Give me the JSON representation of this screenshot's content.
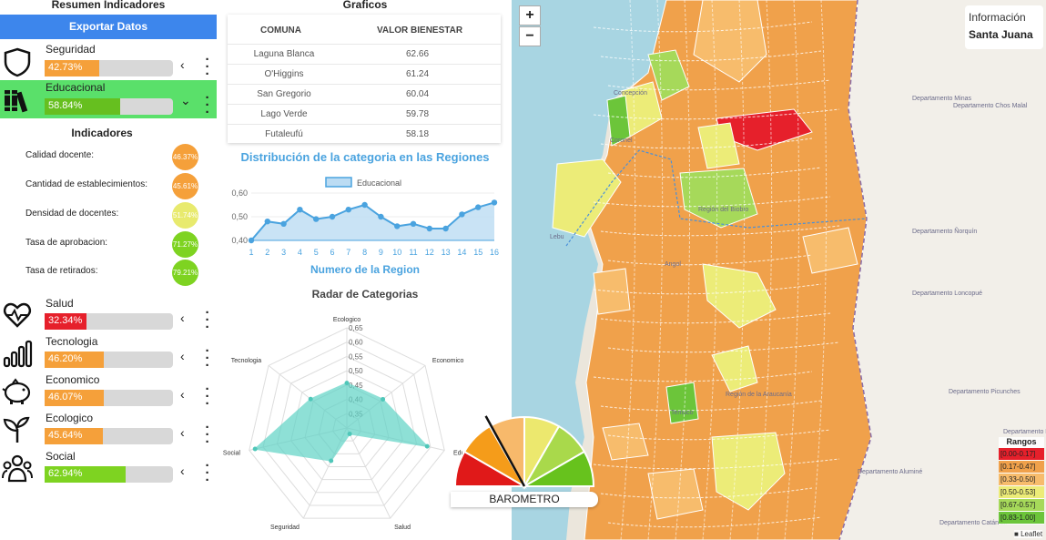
{
  "left": {
    "title": "Resumen Indicadores",
    "export_label": "Exportar Datos",
    "categories": [
      {
        "name": "Seguridad",
        "value": "42.73%",
        "pct": 42.73,
        "color": "#f5a03a",
        "icon": "shield-icon",
        "chevron": "‹"
      },
      {
        "name": "Educacional",
        "value": "58.84%",
        "pct": 58.84,
        "color": "#66bf1f",
        "icon": "books-icon",
        "chevron": "⌄"
      },
      {
        "name": "Salud",
        "value": "32.34%",
        "pct": 32.34,
        "color": "#e6202b",
        "icon": "heart-pulse-icon",
        "chevron": "‹"
      },
      {
        "name": "Tecnologia",
        "value": "46.20%",
        "pct": 46.2,
        "color": "#f5a03a",
        "icon": "signal-bars-icon",
        "chevron": "‹"
      },
      {
        "name": "Economico",
        "value": "46.07%",
        "pct": 46.07,
        "color": "#f5a03a",
        "icon": "piggy-bank-icon",
        "chevron": "‹"
      },
      {
        "name": "Ecologico",
        "value": "45.64%",
        "pct": 45.64,
        "color": "#f5a03a",
        "icon": "sprout-icon",
        "chevron": "‹"
      },
      {
        "name": "Social",
        "value": "62.94%",
        "pct": 62.94,
        "color": "#7ed321",
        "icon": "people-icon",
        "chevron": "‹"
      }
    ],
    "indicators_title": "Indicadores",
    "indicators": [
      {
        "label": "Calidad docente:",
        "value": "46.37%",
        "color": "#f5a03a"
      },
      {
        "label": "Cantidad de establecimientos:",
        "value": "45.61%",
        "color": "#f5a03a"
      },
      {
        "label": "Densidad de docentes:",
        "value": "51.74%",
        "color": "#e8ea6e"
      },
      {
        "label": "Tasa de aprobacion:",
        "value": "71.27%",
        "color": "#7ed321"
      },
      {
        "label": "Tasa de retirados:",
        "value": "79.21%",
        "color": "#7ed321"
      }
    ]
  },
  "middle": {
    "title": "Graficos",
    "table": {
      "col1": "COMUNA",
      "col2": "VALOR BIENESTAR",
      "rows": [
        {
          "comuna": "Laguna Blanca",
          "valor": "62.66"
        },
        {
          "comuna": "O'Higgins",
          "valor": "61.24"
        },
        {
          "comuna": "San Gregorio",
          "valor": "60.04"
        },
        {
          "comuna": "Lago Verde",
          "valor": "59.78"
        },
        {
          "comuna": "Futaleufú",
          "valor": "58.18"
        }
      ]
    },
    "line_title": "Distribución de la categoria en las Regiones",
    "line_xlabel": "Numero de la Region",
    "radar_title": "Radar de Categorias"
  },
  "chart_data": [
    {
      "type": "line",
      "title": "Distribución de la categoria en las Regiones",
      "xlabel": "Numero de la Region",
      "x": [
        1,
        2,
        3,
        4,
        5,
        6,
        7,
        8,
        9,
        10,
        11,
        12,
        13,
        14,
        15,
        16
      ],
      "series": [
        {
          "name": "Educacional",
          "values": [
            0.4,
            0.48,
            0.47,
            0.53,
            0.49,
            0.5,
            0.53,
            0.55,
            0.5,
            0.46,
            0.47,
            0.45,
            0.45,
            0.51,
            0.54,
            0.56
          ]
        }
      ],
      "ylim": [
        0.4,
        0.6
      ],
      "yticks": [
        "0,40",
        "0,50",
        "0,60"
      ],
      "legend": "top-center",
      "color": "#4aa3df"
    },
    {
      "type": "radar",
      "title": "Radar de Categorias",
      "axes": [
        "Ecologico",
        "Economico",
        "Educacional",
        "Salud",
        "Seguridad",
        "Social",
        "Tecnologia"
      ],
      "values": [
        0.457,
        0.461,
        0.588,
        0.323,
        0.427,
        0.629,
        0.462
      ],
      "rticks": [
        "0,30",
        "0,35",
        "0,40",
        "0,45",
        "0,50",
        "0,55",
        "0,60",
        "0,65"
      ],
      "rmin": 0.3,
      "rmax": 0.65,
      "color": "#5fd3c6"
    }
  ],
  "map": {
    "zoom_in": "+",
    "zoom_out": "−",
    "info_title": "Información",
    "info_value": "Santa Juana",
    "legend_title": "Rangos",
    "legend": [
      {
        "label": "[0.00-0.17]",
        "color": "#e6202b"
      },
      {
        "label": "[0.17-0.47]",
        "color": "#f0a14b"
      },
      {
        "label": "[0.33-0.50]",
        "color": "#f7bc6c"
      },
      {
        "label": "[0.50-0.53]",
        "color": "#ecec78"
      },
      {
        "label": "[0.67-0.57]",
        "color": "#a6d95a"
      },
      {
        "label": "[0.83-1.00]",
        "color": "#6cc53a"
      }
    ],
    "barometer_label": "BAROMETRO",
    "attribution": "Leaflet",
    "place_labels": [
      "Concepción",
      "Coronel",
      "Lebu",
      "Angol",
      "Temuco",
      "Región del Biobío",
      "Región de la Araucanía",
      "Departamento Minas",
      "Departamento Chos Malal",
      "Departamento Ñorquín",
      "Departamento Loncopué",
      "Departamento Picunches",
      "Departamento Aluminé",
      "Departamento Catán Lil",
      "Departamento Huiliches"
    ]
  }
}
